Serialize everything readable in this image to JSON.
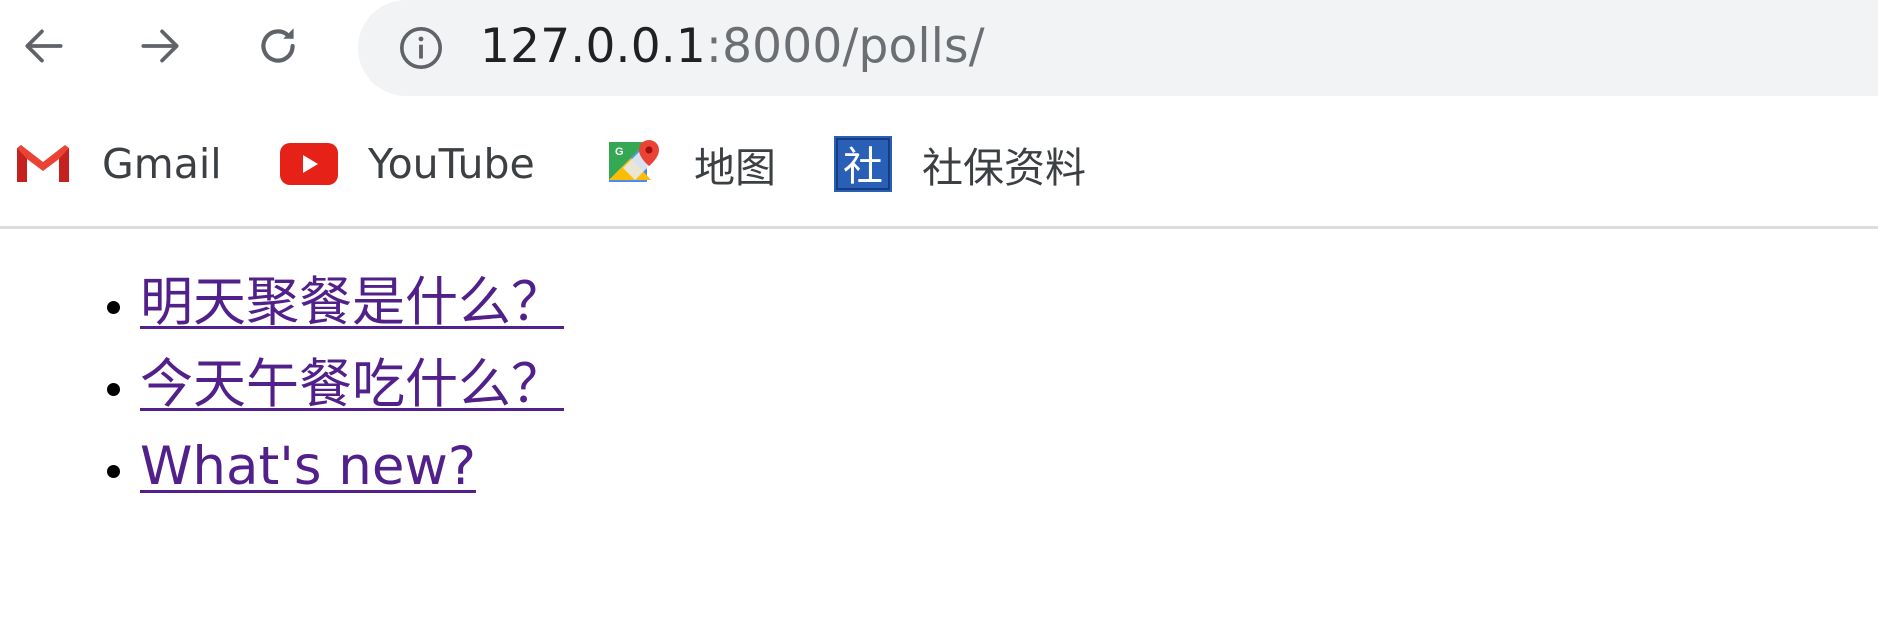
{
  "browser": {
    "back_icon": "arrow-left-icon",
    "forward_icon": "arrow-right-icon",
    "reload_icon": "reload-icon",
    "info_icon": "info-circle-icon",
    "url_host": "127.0.0.1",
    "url_rest": ":8000/polls/"
  },
  "bookmarks": [
    {
      "label": "Gmail",
      "icon": "gmail-icon"
    },
    {
      "label": "YouTube",
      "icon": "youtube-icon"
    },
    {
      "label": "地图",
      "icon": "maps-icon"
    },
    {
      "label": "社保资料",
      "icon": "shebao-icon",
      "icon_text": "社"
    }
  ],
  "polls": {
    "items": [
      {
        "text": "明天聚餐是什么？"
      },
      {
        "text": "今天午餐吃什么？"
      },
      {
        "text": "What's new?"
      }
    ]
  },
  "colors": {
    "link_visited": "#52208a",
    "omnibox_bg": "#f1f3f4",
    "youtube_red": "#e62117",
    "shebao_blue": "#2a5fb8"
  }
}
